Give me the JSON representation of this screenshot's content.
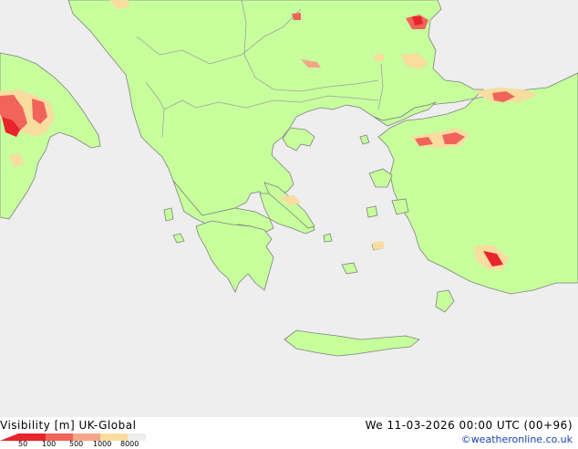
{
  "map": {
    "sea_color": "#eeeeee",
    "land_color": "#c6ff9c",
    "border_color": "#a0a0a0",
    "coast_color": "#808080",
    "low_vis_colors": [
      "#e8242c",
      "#f0645a",
      "#f6a48a",
      "#f8dca0"
    ]
  },
  "footer": {
    "title": "Visibility [m] UK-Global",
    "datetime": "We 11-03-2026 00:00 UTC (00+96)",
    "credit": "©weatheronline.co.uk",
    "legend": {
      "labels": [
        "50",
        "100",
        "500",
        "1000",
        "8000"
      ],
      "colors": [
        "#e8242c",
        "#f0645a",
        "#f6a48a",
        "#f8dca0",
        "#eeeeee"
      ]
    }
  }
}
